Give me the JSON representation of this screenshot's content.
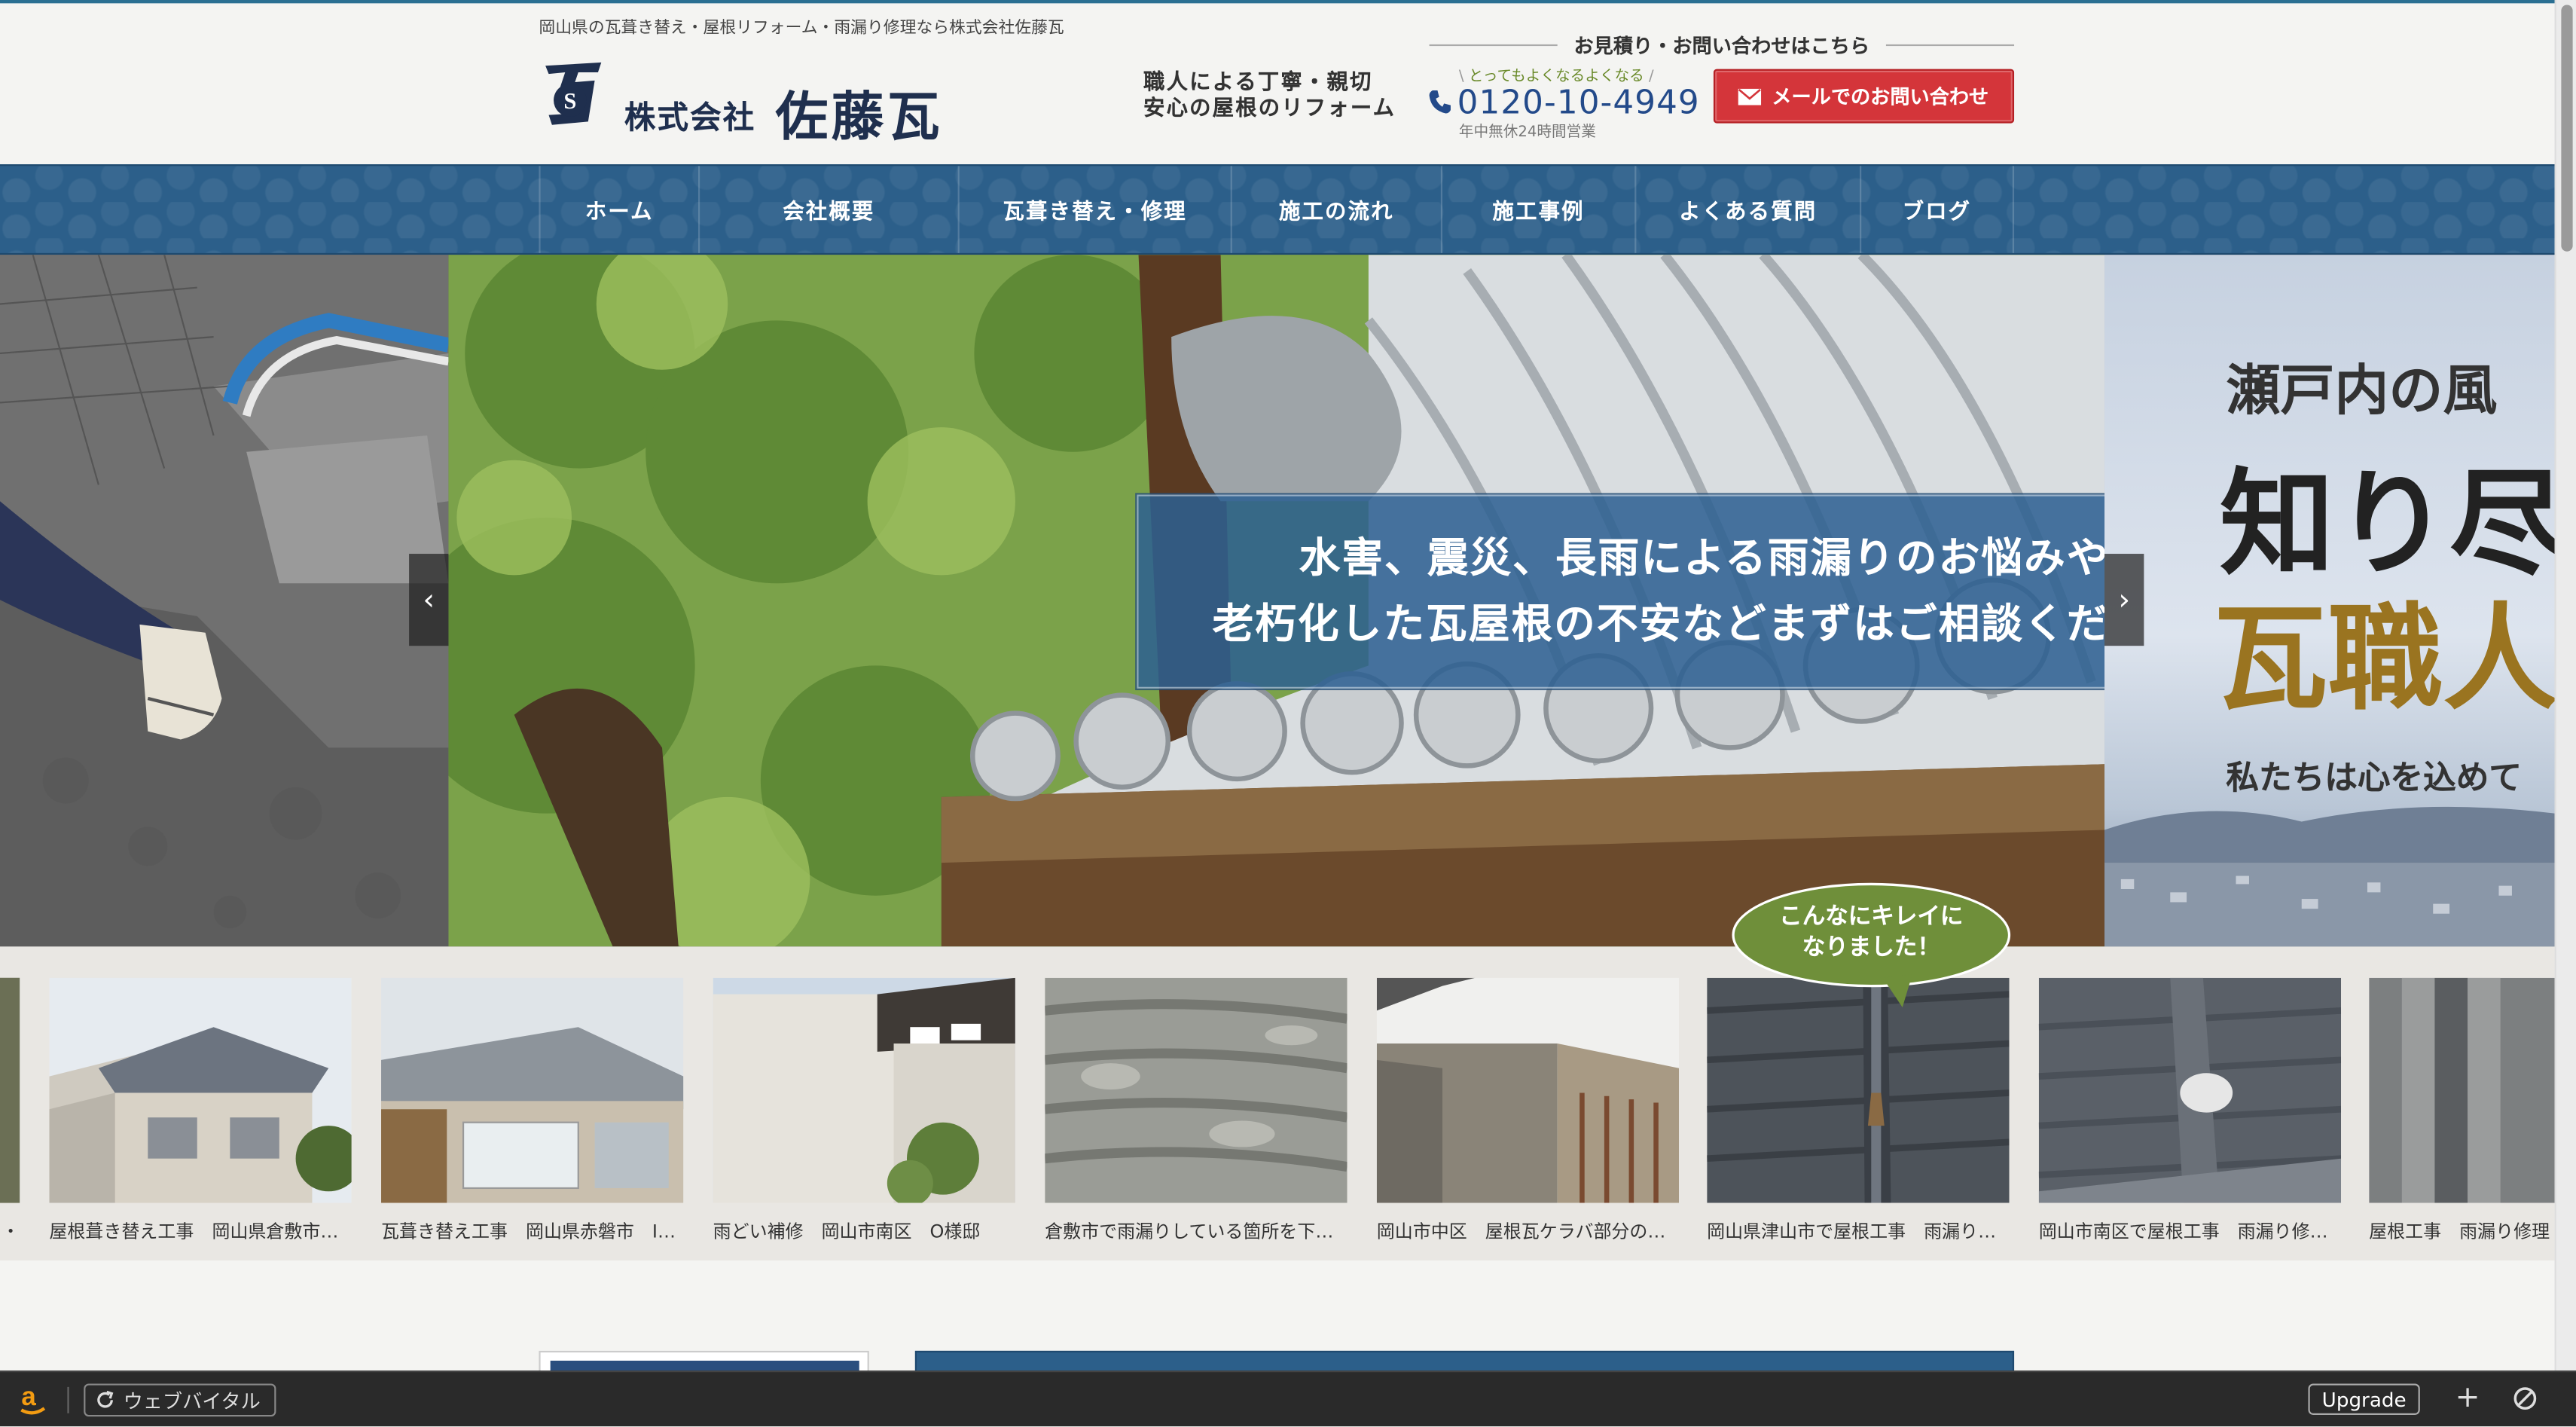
{
  "header": {
    "tagline": "岡山県の瓦葺き替え・屋根リフォーム・雨漏り修理なら株式会社佐藤瓦",
    "logo_company_type": "株式会社",
    "logo_name": "佐藤瓦",
    "catch_line1": "職人による丁寧・親切",
    "catch_line2": "安心の屋根のリフォーム",
    "contact_heading": "お見積り・お問い合わせはこちら",
    "tel_sub": "とってもよくなるよくなる",
    "tel_number": "0120-10-4949",
    "tel_hours": "年中無休24時間営業",
    "mail_button": "メールでのお問い合わせ"
  },
  "nav": {
    "items": [
      {
        "label": "ホーム"
      },
      {
        "label": "会社概要"
      },
      {
        "label": "瓦葺き替え・修理"
      },
      {
        "label": "施工の流れ"
      },
      {
        "label": "施工事例"
      },
      {
        "label": "よくある質問"
      },
      {
        "label": "ブログ"
      }
    ]
  },
  "hero": {
    "caption_line1": "水害、震災、長雨による雨漏りのお悩みや、",
    "caption_line2": "老朽化した瓦屋根の不安などまずはご相談ください。",
    "next_slide_line1": "瀬戸内の風",
    "next_slide_line2": "知り尽",
    "next_slide_line3": "瓦職人",
    "next_slide_line4": "私たちは心を込めて",
    "prev_arrow": "‹",
    "next_arrow": "›"
  },
  "works": {
    "bubble_line1": "こんなにキレイに",
    "bubble_line2": "なりました！",
    "items": [
      {
        "caption": "屋根葺き替え工事　岡山県倉敷市…"
      },
      {
        "caption": "瓦葺き替え工事　岡山県赤磐市　I…"
      },
      {
        "caption": "雨どい補修　岡山市南区　O様邸"
      },
      {
        "caption": "倉敷市で雨漏りしている箇所を下…"
      },
      {
        "caption": "岡山市中区　屋根瓦ケラバ部分の…"
      },
      {
        "caption": "岡山県津山市で屋根工事　雨漏り…"
      },
      {
        "caption": "岡山市南区で屋根工事　雨漏り修…"
      },
      {
        "caption": "屋根工事　雨漏り修理"
      }
    ],
    "left_partial_caption": "・"
  },
  "bottombar": {
    "vitals_label": "ウェブバイタル",
    "upgrade_label": "Upgrade",
    "plus_label": "+"
  },
  "colors": {
    "brand_navy": "#1f2f4e",
    "nav_blue": "#2c5f8a",
    "mail_red": "#d4353a",
    "bubble_green": "#6f8f3a"
  }
}
